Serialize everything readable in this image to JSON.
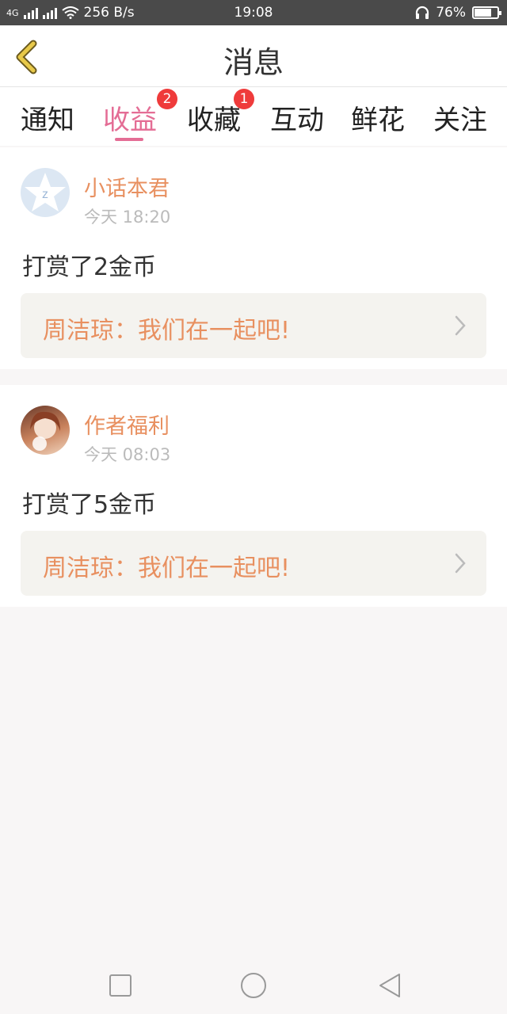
{
  "status_bar": {
    "network_type": "4G",
    "speed": "256 B/s",
    "time": "19:08",
    "battery": "76%",
    "battery_level": 0.76
  },
  "header": {
    "title": "消息"
  },
  "tabs": [
    {
      "label": "通知"
    },
    {
      "label": "收益"
    },
    {
      "label": "收藏"
    },
    {
      "label": "互动"
    },
    {
      "label": "鲜花"
    },
    {
      "label": "关注"
    }
  ],
  "badges": [
    {
      "tab": "收藏",
      "count": "2"
    },
    {
      "tab": "互动",
      "count": "1"
    }
  ],
  "messages": [
    {
      "sender": "小话本君",
      "time": "今天 18:20",
      "text": "打赏了2金币",
      "quote": "周洁琼：我们在一起吧!"
    },
    {
      "sender": "作者福利",
      "time": "今天 08:03",
      "text": "打赏了5金币",
      "quote": "周洁琼：我们在一起吧!"
    }
  ],
  "colors": {
    "accent": "#e46d95",
    "sender": "#e89060",
    "badge": "#ef3b3b",
    "back_arrow": "#e8c94a"
  },
  "icons": {
    "back": "back-arrow-icon",
    "wifi": "wifi-icon",
    "headphone": "headphone-icon",
    "chevron": "chevron-right-icon",
    "nav_recent": "square-icon",
    "nav_home": "circle-icon",
    "nav_back": "triangle-back-icon"
  }
}
